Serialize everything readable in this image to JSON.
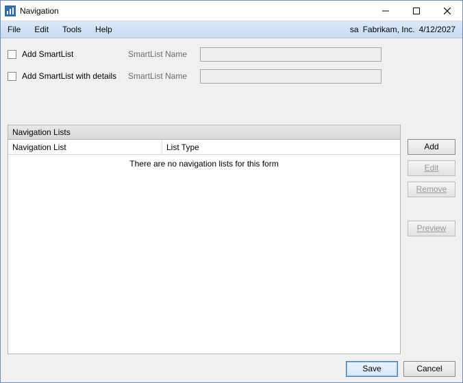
{
  "titlebar": {
    "title": "Navigation"
  },
  "menubar": {
    "file": "File",
    "edit": "Edit",
    "tools": "Tools",
    "help": "Help",
    "user": "sa",
    "company": "Fabrikam, Inc.",
    "date": "4/12/2027"
  },
  "fields": {
    "add_smartlist": "Add SmartList",
    "add_smartlist_with_details": "Add SmartList with details",
    "smartlist_name_label": "SmartList Name",
    "smartlist_name_value1": "",
    "smartlist_name_value2": ""
  },
  "grid": {
    "panel_title": "Navigation Lists",
    "col1": "Navigation List",
    "col2": "List Type",
    "empty_message": "There are no navigation lists for this form"
  },
  "buttons": {
    "add": "Add",
    "edit": "Edit",
    "remove": "Remove",
    "preview": "Preview",
    "save": "Save",
    "cancel": "Cancel"
  }
}
